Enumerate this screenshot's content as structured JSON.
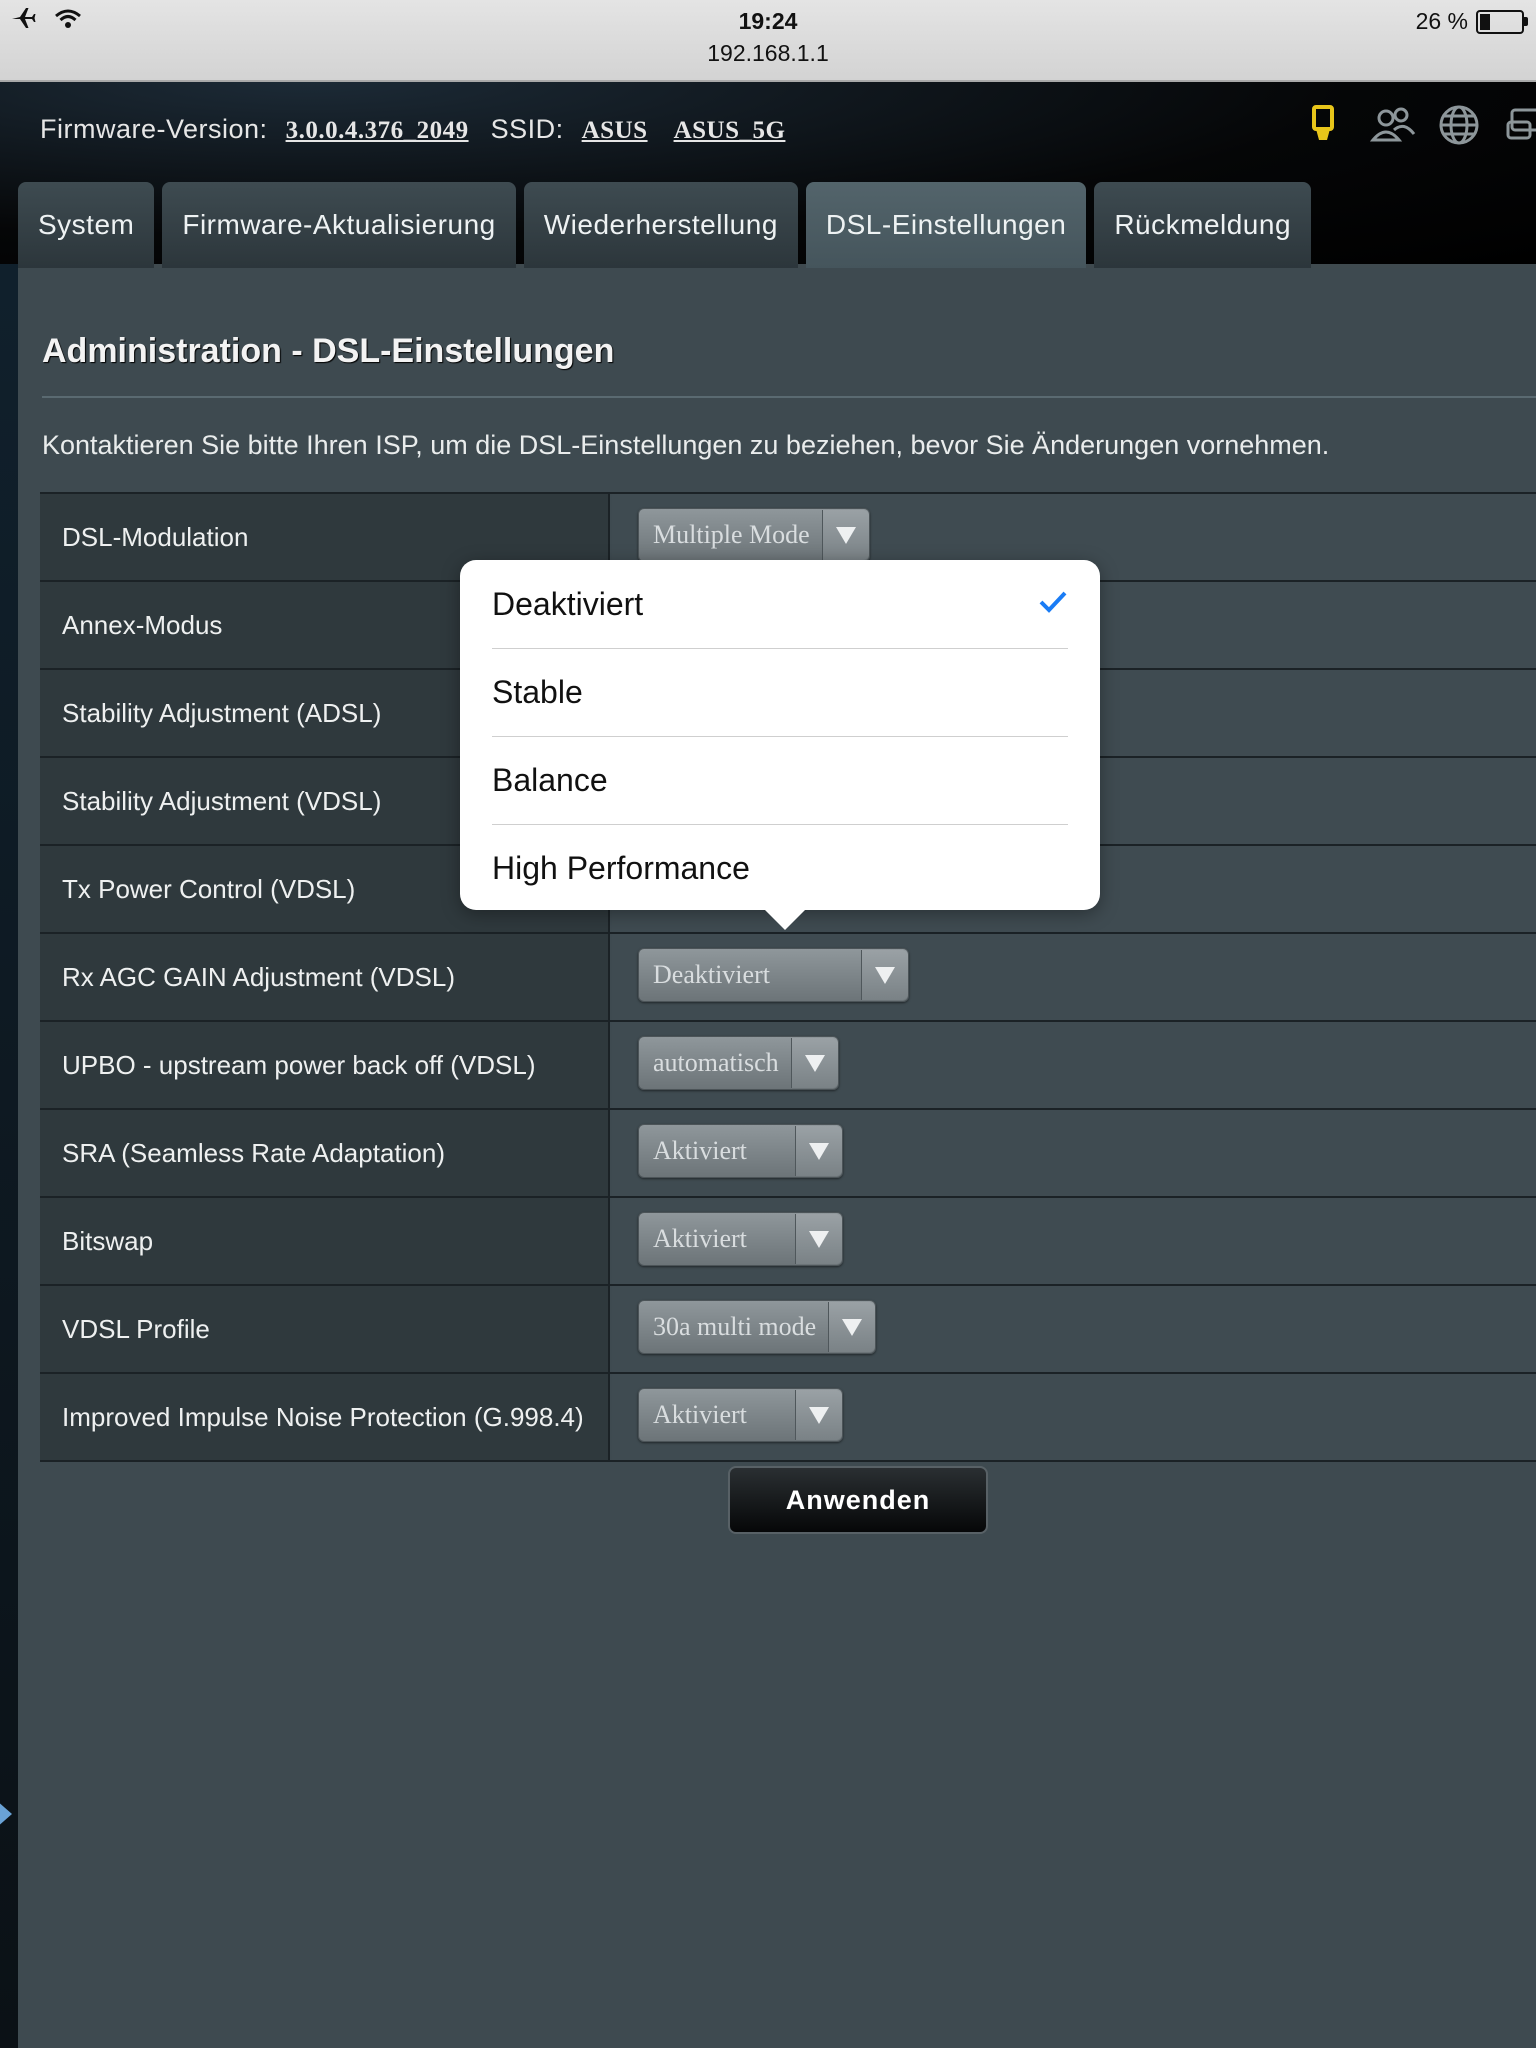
{
  "status_bar": {
    "time": "19:24",
    "url": "192.168.1.1",
    "battery_text": "26 %",
    "battery_level": 0.26,
    "airplane_icon": "airplane-icon",
    "wifi_icon": "wifi-icon"
  },
  "header": {
    "firmware_label": "Firmware-Version:",
    "firmware_value": "3.0.0.4.376_2049",
    "ssid_label": "SSID:",
    "ssid_1": "ASUS",
    "ssid_2": "ASUS_5G",
    "icons": [
      "usb-stick-icon",
      "users-icon",
      "globe-icon",
      "network-icon"
    ],
    "accent": "#e8c51a"
  },
  "tabs": [
    {
      "label": "System"
    },
    {
      "label": "Firmware-Aktualisierung"
    },
    {
      "label": "Wiederherstellung"
    },
    {
      "label": "DSL-Einstellungen",
      "active": true
    },
    {
      "label": "Rückmeldung"
    }
  ],
  "page": {
    "title": "Administration - DSL-Einstellungen",
    "notice": "Kontaktieren Sie bitte Ihren ISP, um die DSL-Einstellungen zu beziehen, bevor Sie Änderungen vornehmen."
  },
  "settings": [
    {
      "label": "DSL-Modulation",
      "value": "Multiple Mode"
    },
    {
      "label": "Annex-Modus",
      "value": ""
    },
    {
      "label": "Stability Adjustment (ADSL)",
      "value": ""
    },
    {
      "label": "Stability Adjustment (VDSL)",
      "value": ""
    },
    {
      "label": "Tx Power Control (VDSL)",
      "value": ""
    },
    {
      "label": "Rx AGC GAIN Adjustment (VDSL)",
      "value": "Deaktiviert"
    },
    {
      "label": "UPBO - upstream power back off (VDSL)",
      "value": "automatisch"
    },
    {
      "label": "SRA (Seamless Rate Adaptation)",
      "value": "Aktiviert"
    },
    {
      "label": "Bitswap",
      "value": "Aktiviert"
    },
    {
      "label": "VDSL Profile",
      "value": "30a multi mode"
    },
    {
      "label": "Improved Impulse Noise Protection (G.998.4)",
      "value": "Aktiviert"
    }
  ],
  "apply_label": "Anwenden",
  "popover": {
    "options": [
      "Deaktiviert",
      "Stable",
      "Balance",
      "High Performance"
    ],
    "selected": "Deaktiviert",
    "check_color": "#1a7cf5"
  }
}
